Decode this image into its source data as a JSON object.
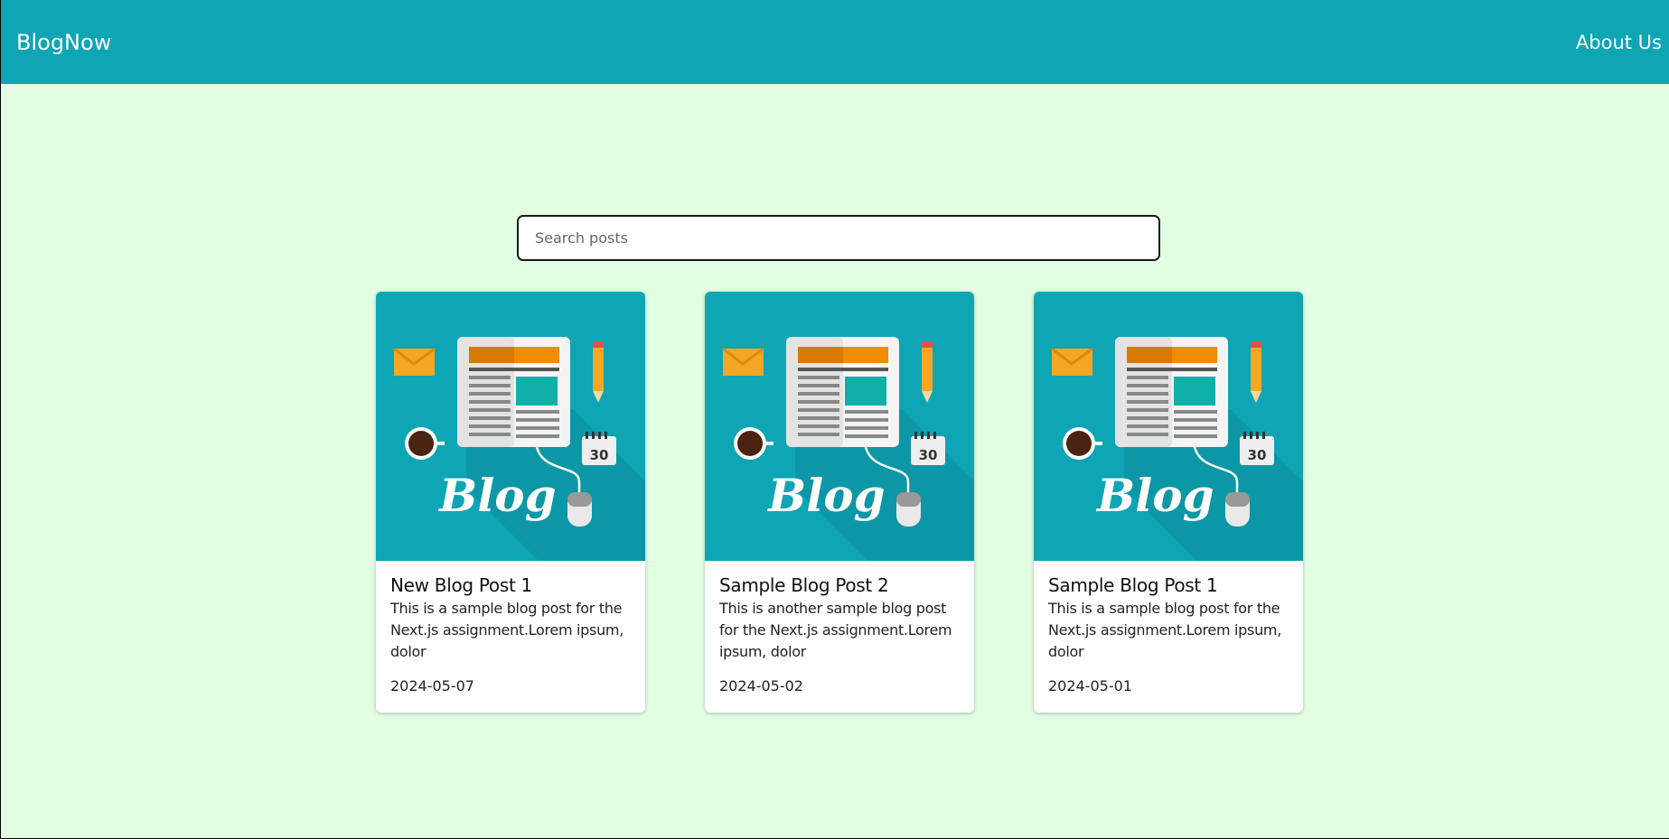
{
  "header": {
    "brand": "BlogNow",
    "about_link": "About Us"
  },
  "search": {
    "placeholder": "Search posts",
    "value": ""
  },
  "posts": [
    {
      "title": "New Blog Post 1",
      "description": "This is a sample blog post for the Next.js assignment.Lorem ipsum, dolor",
      "date": "2024-05-07"
    },
    {
      "title": "Sample Blog Post 2",
      "description": "This is another sample blog post for the Next.js assignment.Lorem ipsum, dolor",
      "date": "2024-05-02"
    },
    {
      "title": "Sample Blog Post 1",
      "description": "This is a sample blog post for the Next.js assignment.Lorem ipsum, dolor",
      "date": "2024-05-01"
    }
  ],
  "thumbnail": {
    "word": "Blog",
    "calendar_day": "30"
  },
  "colors": {
    "header": "#0ea5b5",
    "page_background": "#e1fee3",
    "thumbnail_background": "#0ea5b5"
  }
}
